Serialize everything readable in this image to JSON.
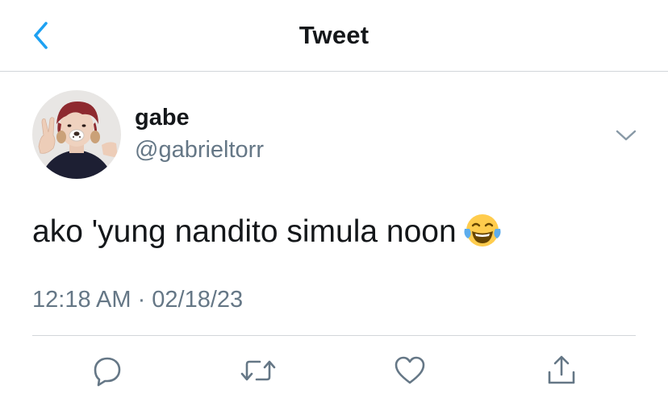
{
  "header": {
    "title": "Tweet",
    "back_icon": "chevron-left-icon"
  },
  "tweet": {
    "author": {
      "display_name": "gabe",
      "handle": "@gabrieltorr"
    },
    "text": "ako 'yung nandito simula noon",
    "emoji": "face-with-tears-of-joy",
    "timestamp": "12:18 AM · 02/18/23"
  },
  "actions": [
    {
      "name": "reply",
      "icon": "comment-icon"
    },
    {
      "name": "retweet",
      "icon": "retweet-icon"
    },
    {
      "name": "like",
      "icon": "heart-icon"
    },
    {
      "name": "share",
      "icon": "share-icon"
    }
  ],
  "colors": {
    "accent": "#1da1f2",
    "text_primary": "#14171a",
    "text_secondary": "#657786",
    "divider": "#d2d6da"
  }
}
